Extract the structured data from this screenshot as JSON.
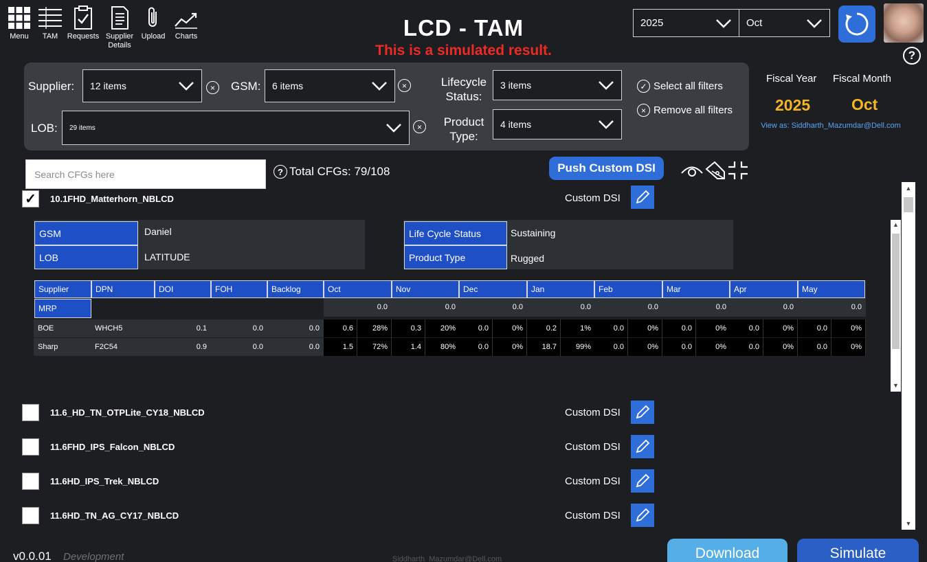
{
  "nav": [
    {
      "label": "Menu",
      "icon": "grid-icon"
    },
    {
      "label": "TAM",
      "icon": "list-icon"
    },
    {
      "label": "Requests",
      "icon": "checklist-icon"
    },
    {
      "label": "Supplier Details",
      "icon": "document-icon"
    },
    {
      "label": "Upload",
      "icon": "paperclip-icon"
    },
    {
      "label": "Charts",
      "icon": "line-chart-icon"
    }
  ],
  "header": {
    "title": "LCD - TAM",
    "subtitle": "This is a simulated result.",
    "year": "2025",
    "month": "Oct",
    "help": "?"
  },
  "filters": {
    "supplier_label": "Supplier:",
    "supplier_value": "12 items",
    "gsm_label": "GSM:",
    "gsm_value": "6 items",
    "lob_label": "LOB:",
    "lob_value": "29 items",
    "lifecycle_label_1": "Lifecycle",
    "lifecycle_label_2": "Status:",
    "lifecycle_value": "3 items",
    "product_label_1": "Product",
    "product_label_2": "Type:",
    "product_value": "4 items",
    "select_all": "Select all filters",
    "remove_all": "Remove all filters",
    "clear_glyph": "×",
    "check_glyph": "✓"
  },
  "fiscal": {
    "year_label": "Fiscal Year",
    "month_label": "Fiscal Month",
    "year_value": "2025",
    "month_value": "Oct",
    "view_as": "View as: Siddharth_Mazumdar@Dell.com"
  },
  "search": {
    "placeholder": "Search CFGs here"
  },
  "total": {
    "q": "?",
    "text": "Total CFGs: 79/108"
  },
  "push_button": "Push Custom DSI",
  "custom_dsi": "Custom DSI",
  "expanded_cfg": {
    "name": "10.1FHD_Matterhorn_NBLCD",
    "checked": "✓",
    "gsm_key": "GSM",
    "gsm_val": "Daniel",
    "lob_key": "LOB",
    "lob_val": "LATITUDE",
    "lcs_key": "Life Cycle Status",
    "lcs_val": "Sustaining",
    "pt_key": "Product Type",
    "pt_val": "Rugged"
  },
  "grid": {
    "headers": [
      "Supplier",
      "DPN",
      "DOI",
      "FOH",
      "Backlog"
    ],
    "months": [
      "Oct",
      "Nov",
      "Dec",
      "Jan",
      "Feb",
      "Mar",
      "Apr",
      "May"
    ],
    "mrp_label": "MRP",
    "mrp_values": [
      "0.0",
      "0.0",
      "0.0",
      "0.0",
      "0.0",
      "0.0",
      "0.0",
      "0.0"
    ],
    "rows": [
      {
        "supplier": "BOE",
        "dpn": "WHCH5",
        "doi": "0.1",
        "foh": "0.0",
        "backlog": "0.0",
        "cells": [
          [
            "0.6",
            "28%"
          ],
          [
            "0.3",
            "20%"
          ],
          [
            "0.0",
            "0%"
          ],
          [
            "0.2",
            "1%"
          ],
          [
            "0.0",
            "0%"
          ],
          [
            "0.0",
            "0%"
          ],
          [
            "0.0",
            "0%"
          ],
          [
            "0.0",
            "0%"
          ]
        ]
      },
      {
        "supplier": "Sharp",
        "dpn": "F2C54",
        "doi": "0.9",
        "foh": "0.0",
        "backlog": "0.0",
        "cells": [
          [
            "1.5",
            "72%"
          ],
          [
            "1.4",
            "80%"
          ],
          [
            "0.0",
            "0%"
          ],
          [
            "18.7",
            "99%"
          ],
          [
            "0.0",
            "0%"
          ],
          [
            "0.0",
            "0%"
          ],
          [
            "0.0",
            "0%"
          ],
          [
            "0.0",
            "0%"
          ]
        ]
      }
    ]
  },
  "cfg_list": [
    "11.6_HD_TN_OTPLite_CY18_NBLCD",
    "11.6FHD_IPS_Falcon_NBLCD",
    "11.6HD_IPS_Trek_NBLCD",
    "11.6HD_TN_AG_CY17_NBLCD"
  ],
  "footer": {
    "version": "v0.0.01",
    "env": "Development",
    "email": "Siddharth_Mazumdar@Dell.com",
    "download": "Download",
    "simulate": "Simulate"
  },
  "colors": {
    "accent": "#2f6ed8",
    "header_blue": "#1f4fc4",
    "alert": "#ee2a24",
    "fiscal": "#f6b524"
  }
}
